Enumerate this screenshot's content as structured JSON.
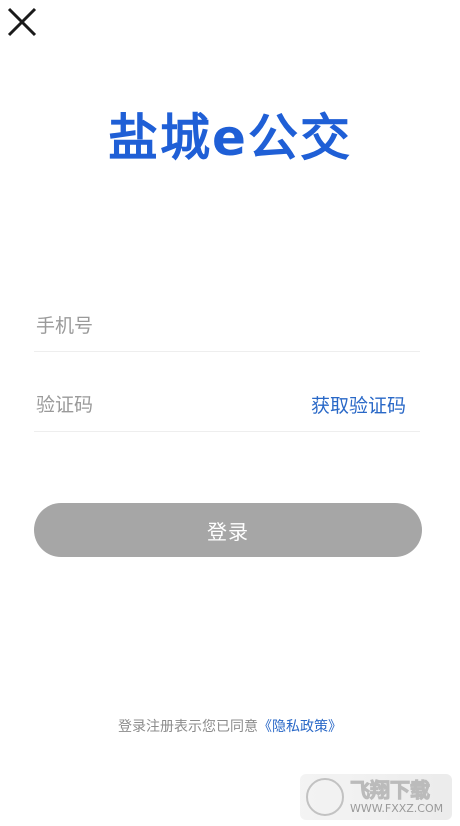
{
  "colors": {
    "brand_blue": "#1f5fd6",
    "link_blue": "#2968c7",
    "button_gray": "#a6a6a6"
  },
  "header": {
    "close_icon": "close-icon"
  },
  "logo": {
    "text": "盐城e公交"
  },
  "form": {
    "phone_placeholder": "手机号",
    "code_placeholder": "验证码",
    "get_code_label": "获取验证码",
    "login_label": "登录"
  },
  "agreement": {
    "prefix": "登录注册表示您已同意",
    "policy_link": "《隐私政策》"
  },
  "watermark": {
    "cn": "飞翔下载",
    "en": "WWW.FXXZ.COM"
  }
}
